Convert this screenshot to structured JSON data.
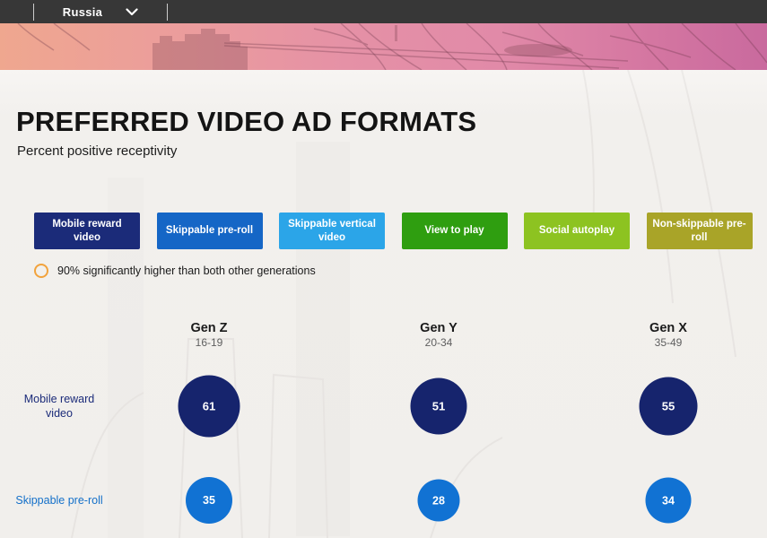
{
  "topbar": {
    "country_selector": {
      "value": "Russia",
      "chevron_icon": "chevron-down"
    }
  },
  "page": {
    "title": "PREFERRED VIDEO AD FORMATS",
    "subtitle": "Percent positive receptivity"
  },
  "filters": [
    {
      "label": "Mobile reward video",
      "color": "#1b2b79"
    },
    {
      "label": "Skippable pre-roll",
      "color": "#1566c6"
    },
    {
      "label": "Skippable vertical video",
      "color": "#2ba5e8"
    },
    {
      "label": "View to play",
      "color": "#2f9e10"
    },
    {
      "label": "Social autoplay",
      "color": "#8dc321"
    },
    {
      "label": "Non-skippable pre-roll",
      "color": "#a9a428"
    }
  ],
  "legend": {
    "marker_icon": "orange-circle-outline",
    "marker_color": "#f2a33c",
    "text": "90% significantly higher than both other generations"
  },
  "chart_data": {
    "type": "table",
    "note": "bubble matrix; bubble area scales with value",
    "columns": [
      {
        "label": "Gen Z",
        "range": "16-19"
      },
      {
        "label": "Gen Y",
        "range": "20-34"
      },
      {
        "label": "Gen X",
        "range": "35-49"
      }
    ],
    "rows": [
      {
        "label": "Mobile reward video",
        "bubble_color": "#16246d",
        "label_color": "#1b2b79",
        "values": [
          61,
          51,
          55
        ]
      },
      {
        "label": "Skippable pre-roll",
        "bubble_color": "#1172d3",
        "label_color": "#1470c9",
        "values": [
          35,
          28,
          34
        ]
      }
    ]
  }
}
